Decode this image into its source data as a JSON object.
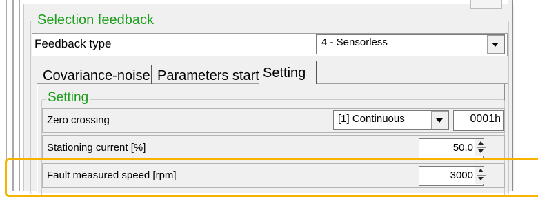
{
  "selection_group": {
    "title": "Selection feedback",
    "feedback_type": {
      "label": "Feedback type",
      "selected": "4 - Sensorless"
    }
  },
  "tabs": [
    {
      "label": "Covariance-noise"
    },
    {
      "label": "Parameters start"
    },
    {
      "label": "Setting",
      "active": true
    }
  ],
  "setting_group": {
    "title": "Setting",
    "rows": [
      {
        "label": "Zero crossing",
        "select_value": "[1] Continuous",
        "hex_value": "0001h"
      },
      {
        "label": "Stationing current [%]",
        "value": "50.0"
      },
      {
        "label": "Fault measured speed [rpm]",
        "value": "3000",
        "highlighted": true
      }
    ]
  },
  "colors": {
    "group_title": "#1c9e1c",
    "highlight": "#f6b400",
    "panel_bg": "#f0f0f0"
  }
}
